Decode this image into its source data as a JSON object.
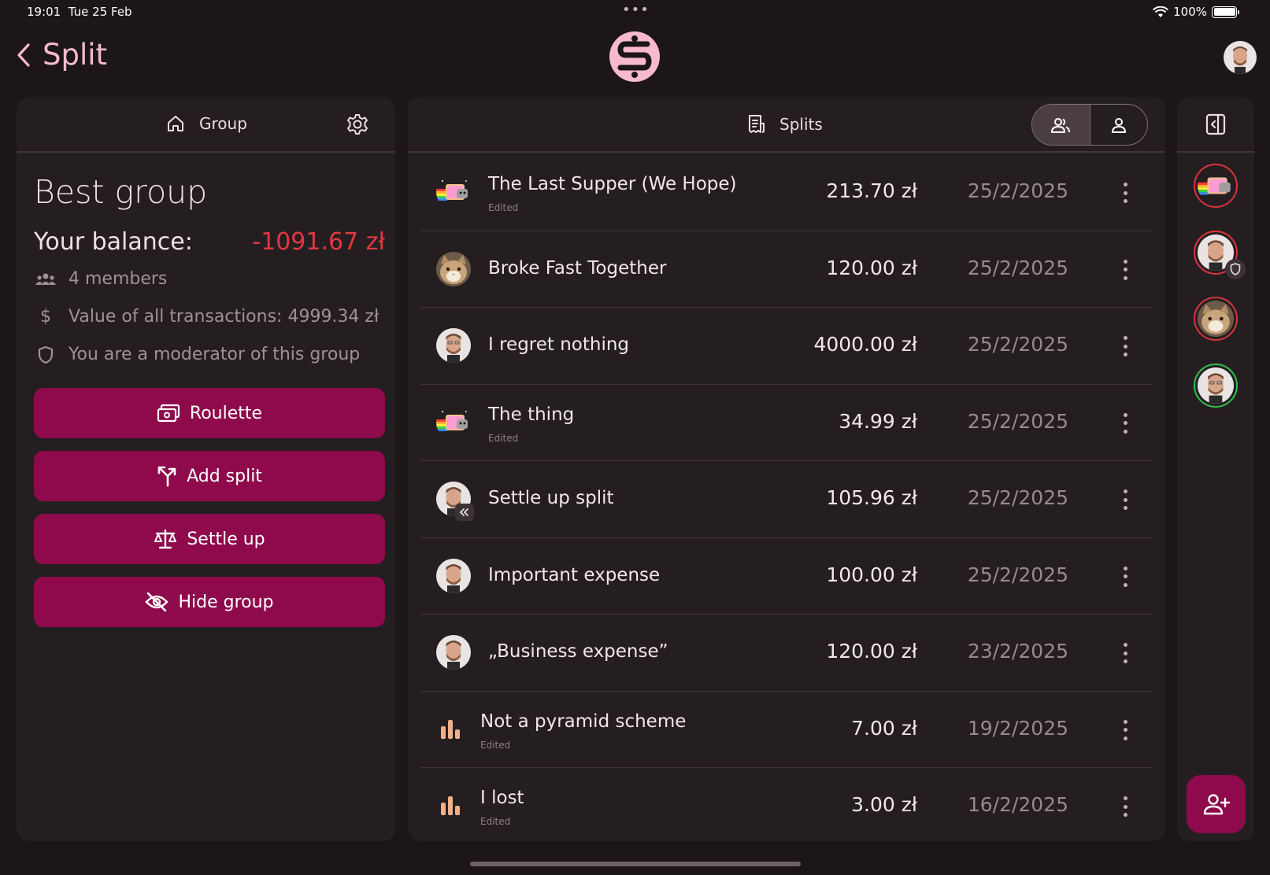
{
  "status_bar": {
    "time": "19:01",
    "date": "Tue 25 Feb",
    "battery": "100%"
  },
  "header": {
    "title": "Split",
    "back_icon": "chevron-left-icon",
    "logo_icon": "split-logo-icon"
  },
  "colors": {
    "accent": "#8e0a4c",
    "accent_text": "#f6b9ce",
    "negative": "#e2383f",
    "panel": "#241e21",
    "background": "#1c1618"
  },
  "group_panel": {
    "tab_label": "Group",
    "group_name": "Best group",
    "balance_label": "Your balance:",
    "balance_value": "-1091.67 zł",
    "members": "4 members",
    "transactions_value": "Value of all transactions: 4999.34 zł",
    "moderator_note": "You are a moderator of this group",
    "buttons": {
      "roulette": "Roulette",
      "add_split": "Add split",
      "settle_up": "Settle up",
      "hide_group": "Hide group"
    }
  },
  "splits_panel": {
    "tab_label": "Splits",
    "splits": [
      {
        "name": "The Last Supper (We Hope)",
        "sub": "Edited",
        "amount": "213.70 zł",
        "date": "25/2/2025",
        "icon": "nyan-cat-avatar"
      },
      {
        "name": "Broke Fast Together",
        "sub": "",
        "amount": "120.00 zł",
        "date": "25/2/2025",
        "icon": "cat-avatar"
      },
      {
        "name": "I regret nothing",
        "sub": "",
        "amount": "4000.00 zł",
        "date": "25/2/2025",
        "icon": "man-avatar"
      },
      {
        "name": "The thing",
        "sub": "Edited",
        "amount": "34.99 zł",
        "date": "25/2/2025",
        "icon": "nyan-cat-avatar"
      },
      {
        "name": "Settle up split",
        "sub": "",
        "amount": "105.96 zł",
        "date": "25/2/2025",
        "icon": "man-avatar-settle"
      },
      {
        "name": "Important expense",
        "sub": "",
        "amount": "100.00 zł",
        "date": "25/2/2025",
        "icon": "man-avatar"
      },
      {
        "name": "„Business expense”",
        "sub": "",
        "amount": "120.00 zł",
        "date": "23/2/2025",
        "icon": "man-avatar"
      },
      {
        "name": "Not a pyramid scheme",
        "sub": "Edited",
        "amount": "7.00 zł",
        "date": "19/2/2025",
        "icon": "bar-chart-icon"
      },
      {
        "name": "I lost",
        "sub": "Edited",
        "amount": "3.00 zł",
        "date": "16/2/2025",
        "icon": "bar-chart-icon"
      }
    ]
  }
}
